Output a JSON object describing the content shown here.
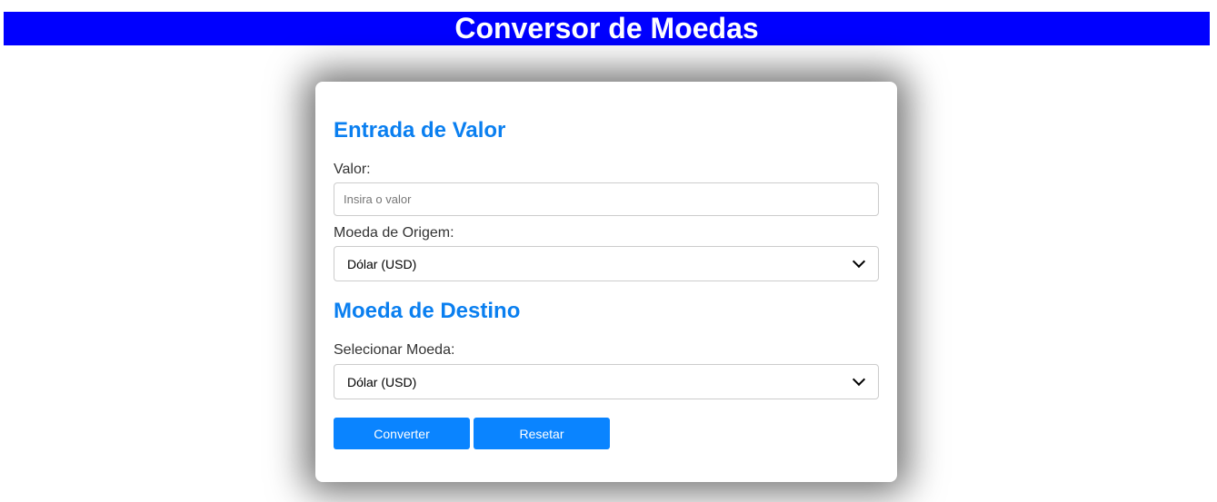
{
  "header": {
    "title": "Conversor de Moedas"
  },
  "input_section": {
    "title": "Entrada de Valor",
    "value_label": "Valor:",
    "value_placeholder": "Insira o valor",
    "value": "",
    "origin_label": "Moeda de Origem:",
    "origin_selected": "Dólar (USD)"
  },
  "destination_section": {
    "title": "Moeda de Destino",
    "select_label": "Selecionar Moeda:",
    "select_selected": "Dólar (USD)"
  },
  "actions": {
    "convert_label": "Converter",
    "reset_label": "Resetar"
  },
  "colors": {
    "header_background": "#0000ff",
    "accent": "#0a7ff0",
    "button": "#0a84ff"
  }
}
